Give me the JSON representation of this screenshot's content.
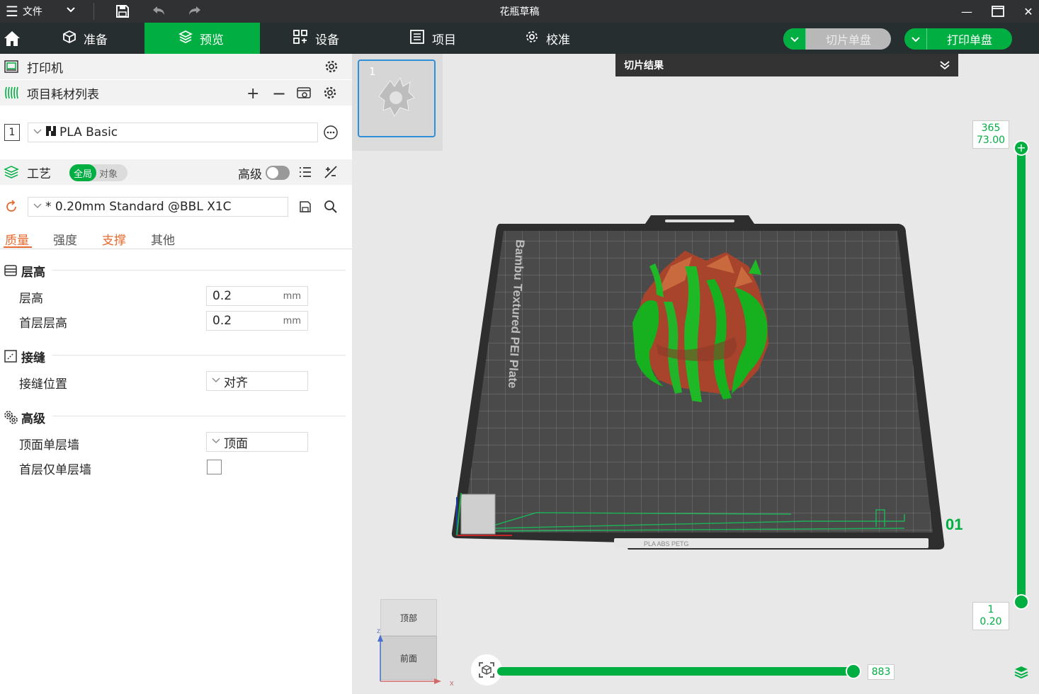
{
  "titlebar": {
    "menu_label": "文件",
    "title": "花瓶草稿"
  },
  "nav": {
    "tabs": [
      {
        "label": "准备"
      },
      {
        "label": "预览",
        "active": true
      },
      {
        "label": "设备"
      },
      {
        "label": "项目"
      },
      {
        "label": "校准"
      }
    ],
    "slice_button": "切片单盘",
    "print_button": "打印单盘",
    "accent": "#00ae42"
  },
  "printer": {
    "label": "打印机"
  },
  "filament": {
    "header": "项目耗材列表",
    "slot_number": "1",
    "name": "PLA Basic"
  },
  "process": {
    "header": "工艺",
    "toggle_global": "全局",
    "toggle_object": "对象",
    "advanced_label": "高级",
    "preset": "* 0.20mm Standard @BBL X1C",
    "tabs": [
      "质量",
      "强度",
      "支撑",
      "其他"
    ]
  },
  "groups": {
    "layer": {
      "title": "层高",
      "layer_height_label": "层高",
      "layer_height_value": "0.2",
      "first_layer_label": "首层层高",
      "first_layer_value": "0.2",
      "unit": "mm"
    },
    "seam": {
      "title": "接缝",
      "position_label": "接缝位置",
      "position_value": "对齐"
    },
    "advanced": {
      "title": "高级",
      "top_wall_label": "顶面单层墙",
      "top_wall_value": "顶面",
      "first_layer_single_label": "首层仅单层墙",
      "first_layer_single_checked": false
    }
  },
  "viewport": {
    "thumb_number": "1",
    "slice_result_title": "切片结果",
    "layer_top": "365",
    "height_top": "73.00",
    "layer_bottom": "1",
    "height_bottom": "0.20",
    "move_value": "883",
    "plate_label": "Bambu Textured PEI Plate",
    "plate_number": "01",
    "plate_strip_text": "PLA ABS PETG",
    "cube_top": "顶部",
    "cube_front": "前面",
    "axis_z": "z",
    "axis_x": "x"
  }
}
